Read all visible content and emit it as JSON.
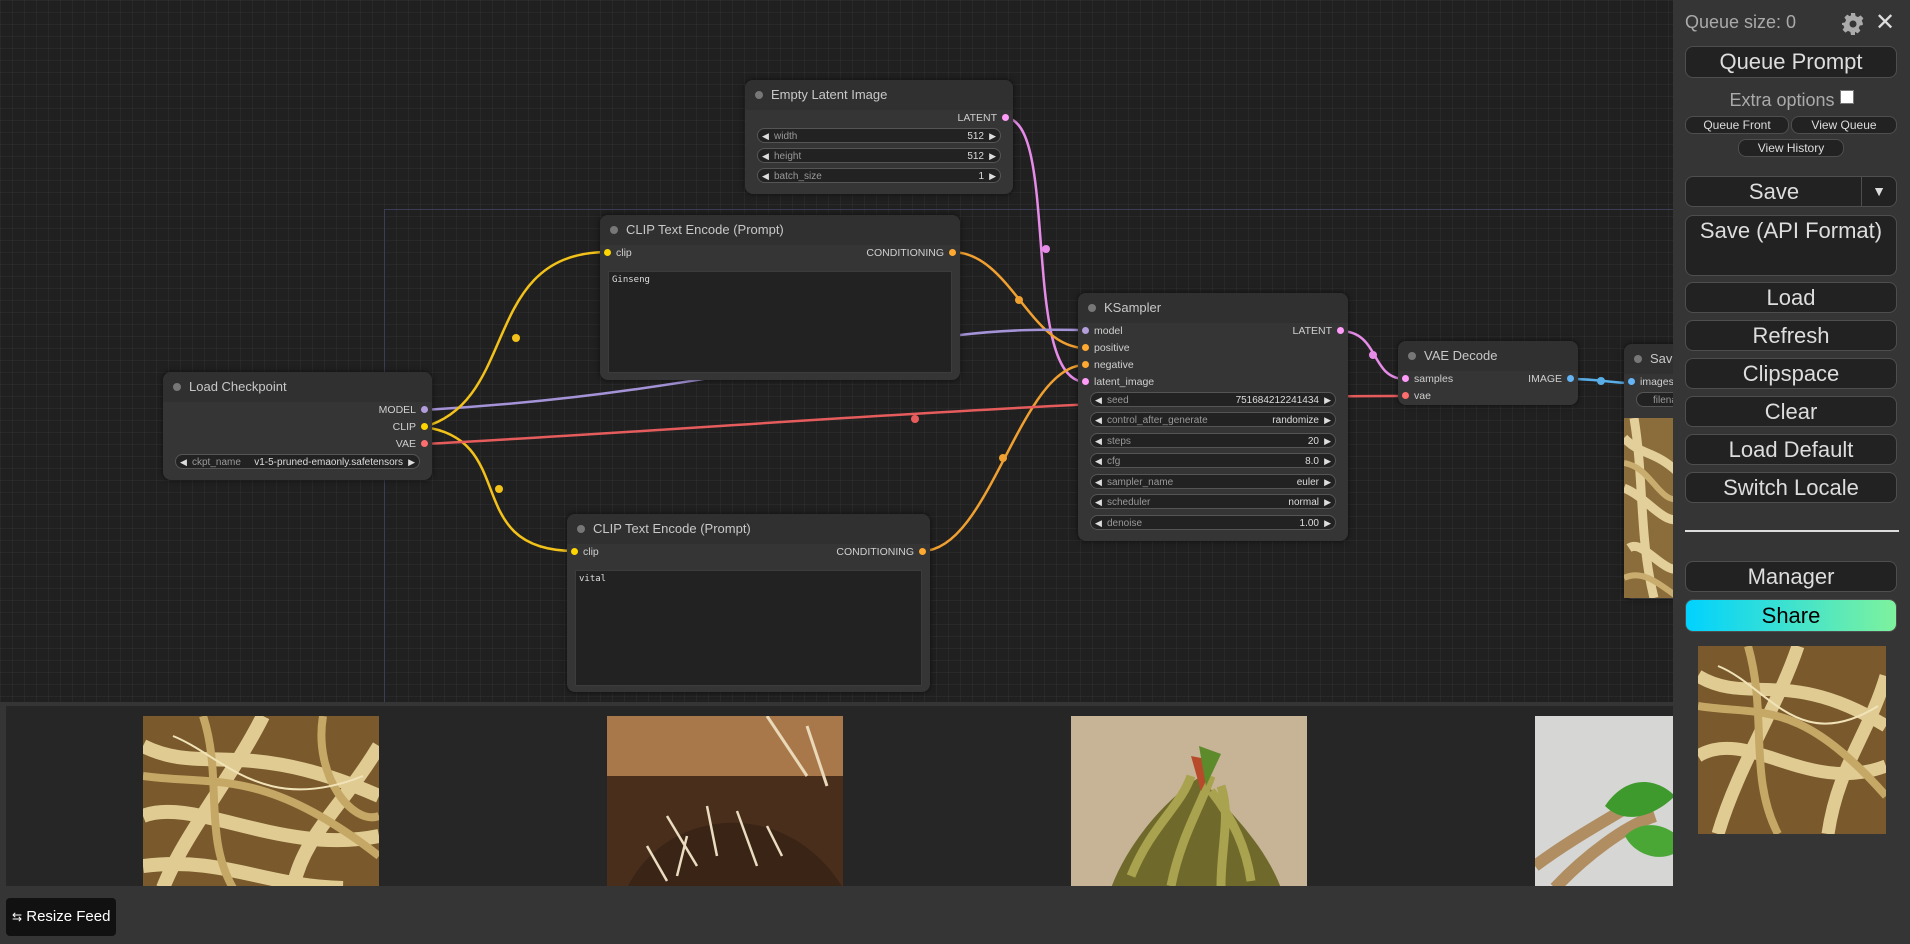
{
  "nodes": {
    "empty_latent": {
      "title": "Empty Latent Image",
      "output": "LATENT",
      "widgets": [
        {
          "label": "width",
          "value": "512"
        },
        {
          "label": "height",
          "value": "512"
        },
        {
          "label": "batch_size",
          "value": "1"
        }
      ]
    },
    "clip_pos": {
      "title": "CLIP Text Encode (Prompt)",
      "input": "clip",
      "output": "CONDITIONING",
      "text": "Ginseng"
    },
    "clip_neg": {
      "title": "CLIP Text Encode (Prompt)",
      "input": "clip",
      "output": "CONDITIONING",
      "text": "vital"
    },
    "load_checkpoint": {
      "title": "Load Checkpoint",
      "outputs": [
        "MODEL",
        "CLIP",
        "VAE"
      ],
      "ckpt_label": "ckpt_name",
      "ckpt_value": "v1-5-pruned-emaonly.safetensors"
    },
    "ksampler": {
      "title": "KSampler",
      "inputs": [
        "model",
        "positive",
        "negative",
        "latent_image"
      ],
      "output": "LATENT",
      "widgets": [
        {
          "label": "seed",
          "value": "751684212241434"
        },
        {
          "label": "control_after_generate",
          "value": "randomize"
        },
        {
          "label": "steps",
          "value": "20"
        },
        {
          "label": "cfg",
          "value": "8.0"
        },
        {
          "label": "sampler_name",
          "value": "euler"
        },
        {
          "label": "scheduler",
          "value": "normal"
        },
        {
          "label": "denoise",
          "value": "1.00"
        }
      ]
    },
    "vae_decode": {
      "title": "VAE Decode",
      "inputs": [
        "samples",
        "vae"
      ],
      "output": "IMAGE"
    },
    "save_image": {
      "title": "Save",
      "input": "images",
      "widget_label": "filena"
    }
  },
  "wire_colors": {
    "model": "#b39ddb",
    "clip": "#ffd500",
    "vae": "#ff6e6e",
    "conditioning": "#ffa931",
    "latent": "#ff9cf9",
    "image": "#64b5f6"
  },
  "feed": {
    "resize_label": "Resize Feed",
    "images": [
      "ginseng-roots-image",
      "soil-sprouts-image",
      "green-roots-on-burlap-image",
      "roots-with-leaves-image"
    ]
  },
  "menu": {
    "queue_size": "Queue size: 0",
    "queue_prompt": "Queue Prompt",
    "extra_options": "Extra options",
    "queue_front": "Queue Front",
    "view_queue": "View Queue",
    "view_history": "View History",
    "save": "Save",
    "save_api": "Save (API Format)",
    "load": "Load",
    "refresh": "Refresh",
    "clipspace": "Clipspace",
    "clear": "Clear",
    "load_default": "Load Default",
    "switch_locale": "Switch Locale",
    "manager": "Manager",
    "share": "Share"
  }
}
